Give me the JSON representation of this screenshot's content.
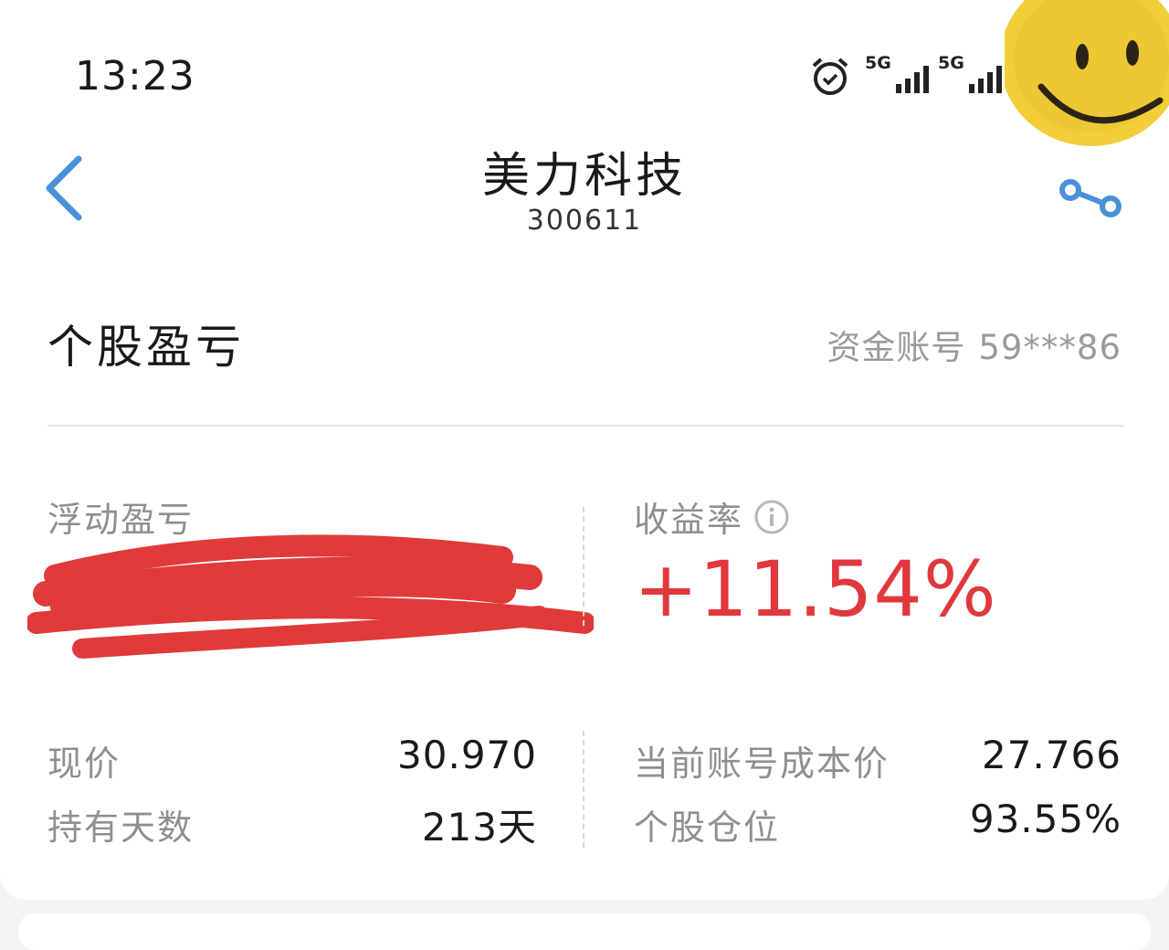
{
  "status_bar": {
    "time": "13:23",
    "network_1": "5G",
    "network_2": "5G",
    "icons": [
      "alarm-icon",
      "signal-5g-icon",
      "signal-5g-icon"
    ]
  },
  "header": {
    "title": "美力科技",
    "code": "300611",
    "back_icon": "chevron-left-icon",
    "share_icon": "share-icon"
  },
  "section": {
    "title": "个股盈亏",
    "account_label": "资金账号",
    "account_number": "59***86"
  },
  "metrics": {
    "floating_pl_label": "浮动盈亏",
    "return_label": "收益率",
    "return_value": "+11.54%",
    "current_price_label": "现价",
    "current_price": "30.970",
    "holding_days_label": "持有天数",
    "holding_days": "213天",
    "cost_price_label": "当前账号成本价",
    "cost_price": "27.766",
    "position_label": "个股仓位",
    "position_value": "93.55%"
  },
  "colors": {
    "accent_blue": "#4a90d9",
    "up_red": "#e0383d",
    "muted_gray": "#8f8f8f"
  }
}
